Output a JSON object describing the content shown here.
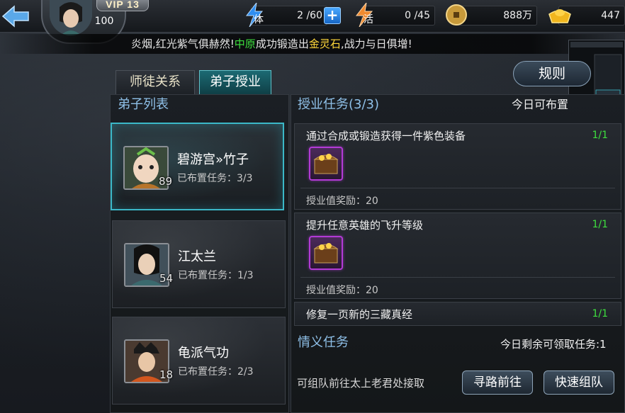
{
  "player": {
    "vip": "VIP 13",
    "level": "100"
  },
  "resources": {
    "stamina_tag": "体",
    "stamina_value": "2 /60",
    "vigor_tag": "活",
    "vigor_value": "0 /45",
    "coins_value": "888万",
    "ingots_value": "447"
  },
  "ticker": {
    "part1": "炎烟,红光紫气俱赫然!",
    "highlight_server": "中原",
    "part2": "成功锻造出",
    "highlight_item": "金灵石",
    "part3": ",战力与日俱增!"
  },
  "tabs": [
    {
      "label": "师徒关系",
      "active": false
    },
    {
      "label": "弟子授业",
      "active": true
    }
  ],
  "rules_button": "规则",
  "left": {
    "header": "弟子列表",
    "disciples": [
      {
        "name": "碧游宫»竹子",
        "level": "89",
        "assigned": "已布置任务：3/3",
        "selected": true
      },
      {
        "name": "江太兰",
        "level": "54",
        "assigned": "已布置任务：1/3",
        "selected": false
      },
      {
        "name": "龟派气功",
        "level": "18",
        "assigned": "已布置任务：2/3",
        "selected": false
      }
    ]
  },
  "right": {
    "header": "授业任务(3/3)",
    "header_right": "今日可布置",
    "tasks": [
      {
        "title": "通过合成或锻造获得一件紫色装备",
        "progress": "1/1",
        "reward": "授业值奖励：20"
      },
      {
        "title": "提升任意英雄的飞升等级",
        "progress": "1/1",
        "reward": "授业值奖励：20"
      },
      {
        "title": "修复一页新的三藏真经",
        "progress": "1/1"
      }
    ],
    "friendship": {
      "header": "情义任务",
      "header_right": "今日剩余可领取任务:1",
      "hint": "可组队前往太上老君处接取",
      "find_path_button": "寻路前往",
      "quick_team_button": "快速组队"
    }
  },
  "colors": {
    "accent_teal": "#3bb8c8",
    "progress_green": "#3ee03e",
    "highlight_yellow": "#ffd83a",
    "header_blue": "#8fc0e8"
  }
}
